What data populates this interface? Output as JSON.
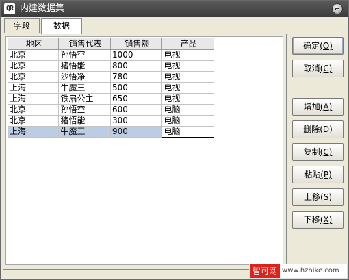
{
  "window": {
    "title": "内建数据集"
  },
  "tabs": [
    {
      "label": "字段",
      "active": false
    },
    {
      "label": "数据",
      "active": true
    }
  ],
  "table": {
    "columns": [
      "地区",
      "销售代表",
      "销售额",
      "产品"
    ],
    "rows": [
      [
        "北京",
        "孙悟空",
        "1000",
        "电视"
      ],
      [
        "北京",
        "猪悟能",
        "800",
        "电视"
      ],
      [
        "北京",
        "沙悟净",
        "780",
        "电视"
      ],
      [
        "上海",
        "牛魔王",
        "500",
        "电视"
      ],
      [
        "上海",
        "铁扇公主",
        "650",
        "电视"
      ],
      [
        "北京",
        "孙悟空",
        "600",
        "电脑"
      ],
      [
        "北京",
        "猪悟能",
        "300",
        "电脑"
      ],
      [
        "上海",
        "牛魔王",
        "900",
        "电脑"
      ]
    ],
    "selected_row": 7
  },
  "buttons": {
    "ok": {
      "label": "确定",
      "key": "(O)"
    },
    "cancel": {
      "label": "取消",
      "key": "(C)"
    },
    "add": {
      "label": "增加",
      "key": "(A)"
    },
    "delete": {
      "label": "删除",
      "key": "(D)"
    },
    "copy": {
      "label": "复制",
      "key": "(C)"
    },
    "paste": {
      "label": "粘贴",
      "key": "(P)"
    },
    "move_up": {
      "label": "上移",
      "key": "(S)"
    },
    "move_down": {
      "label": "下移",
      "key": "(X)"
    }
  },
  "watermark": {
    "brand": "智可网",
    "url": "www.hzhike.com"
  }
}
